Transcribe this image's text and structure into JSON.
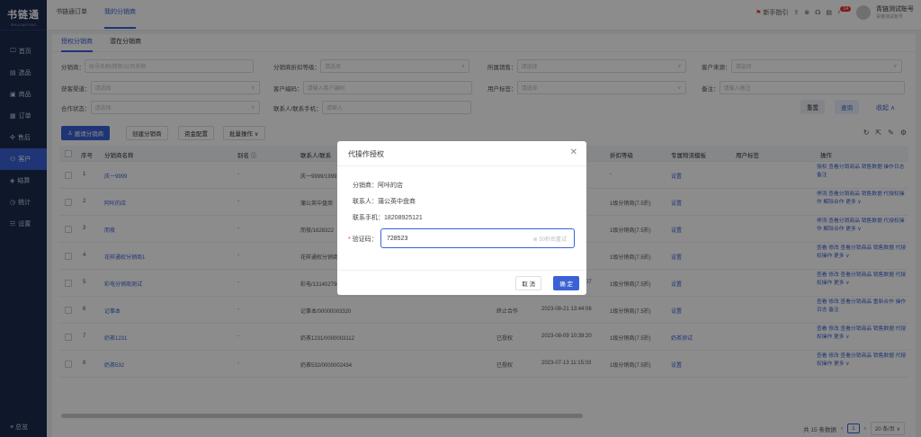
{
  "app": {
    "name": "书链通",
    "subname": "SHULIANTONG"
  },
  "sidebar": {
    "items": [
      {
        "icon": "🖵",
        "label": "首页"
      },
      {
        "icon": "▤",
        "label": "选品"
      },
      {
        "icon": "▣",
        "label": "商品"
      },
      {
        "icon": "▦",
        "label": "订单"
      },
      {
        "icon": "✣",
        "label": "售后"
      },
      {
        "icon": "⚇",
        "label": "客户"
      },
      {
        "icon": "◈",
        "label": "结算"
      },
      {
        "icon": "◷",
        "label": "统计"
      },
      {
        "icon": "☷",
        "label": "设置"
      }
    ],
    "footer": "≡ 总览"
  },
  "topbar": {
    "tabs": [
      "书链通订单",
      "我的分销商"
    ],
    "guide": "新手指引",
    "badge": "14",
    "user": "青链测试账号",
    "role": "青链测试账号"
  },
  "subtabs": [
    "授权分销商",
    "潜在分销商"
  ],
  "filters": {
    "distributor_label": "分销商：",
    "distributor_placeholder": "账号名称/简称/公司名称",
    "discount_label": "分销商折扣等级：",
    "discount_placeholder": "请选择",
    "sales_label": "所属销售：",
    "sales_placeholder": "请选择",
    "source_label": "客户来源：",
    "source_placeholder": "请选择",
    "channel_label": "获客渠道：",
    "channel_placeholder": "请选择",
    "code_label": "客户编码：",
    "code_placeholder": "请输入客户编码",
    "tag_label": "用户标签：",
    "tag_placeholder": "请选择",
    "note_label": "备注：",
    "note_placeholder": "请输入备注",
    "coop_label": "合作状态：",
    "coop_placeholder": "请选择",
    "contact_label": "联系人/联系手机：",
    "contact_placeholder": "请输入",
    "reset": "重置",
    "search": "查询",
    "collapse": "收起 ∧"
  },
  "actions": {
    "invite": "邀请分销商",
    "create": "创建分销商",
    "fund": "资金配置",
    "batch": "批量操作 ∨"
  },
  "table": {
    "headers": [
      "序号",
      "分销商名称",
      "别名 ⓘ",
      "联系人/联系",
      "",
      "",
      "折扣等级",
      "专属物流模板",
      "用户标签",
      "操作"
    ],
    "rows": [
      {
        "no": "1",
        "name": "庆一9999",
        "alias": "-",
        "contact": "庆一9999/1999",
        "status": "",
        "date": "",
        "level": "-",
        "tpl": "设置",
        "ops": "授权 查看分销商品 销售数据 操作日志 备注"
      },
      {
        "no": "2",
        "name": "阿咔的店",
        "alias": "-",
        "contact": "蒲公英中盘商",
        "status": "",
        "date": "43",
        "level": "1级分销商(7.5折)",
        "tpl": "设置",
        "ops": "停流 查看分销商品 销售数据 代授权操作 解除合作 更多 ∨"
      },
      {
        "no": "3",
        "name": "而夜",
        "alias": "-",
        "contact": "而夜/1828322",
        "status": "",
        "date": "52",
        "level": "1级分销商(7.5折)",
        "tpl": "设置",
        "ops": "停流 查看分销商品 销售数据 代授权操作 解除合作 更多 ∨"
      },
      {
        "no": "4",
        "name": "花样通权分销商1",
        "alias": "-",
        "contact": "花样通权分销商",
        "status": "",
        "date": "36",
        "level": "1级分销商(7.5折)",
        "tpl": "设置",
        "ops": "查看 修改 查看分销商品 销售数据 代授权操作 更多 ∨"
      },
      {
        "no": "5",
        "name": "彩电分销商测试",
        "alias": "-",
        "contact": "彩电/13140279657",
        "status": "已授权",
        "date": "2023-09-04 16:34:07",
        "level": "1级分销商(7.5折)",
        "tpl": "设置",
        "ops": "查看 修改 查看分销商品 销售数据 代授权操作 更多 ∨"
      },
      {
        "no": "6",
        "name": "记事本",
        "alias": "-",
        "contact": "记事本/00000003320",
        "status": "终止合作",
        "date": "2023-08-21 13:44:06",
        "level": "1级分销商(7.5折)",
        "tpl": "设置",
        "ops": "查看 修改 查看分销商品 重新合作 操作日志 备注"
      },
      {
        "no": "7",
        "name": "奶茶1231",
        "alias": "-",
        "contact": "奶茶1231/0000003112",
        "status": "已授权",
        "date": "2023-08-09 10:39:20",
        "level": "1级分销商(7.5折)",
        "tpl": "奶茶测试",
        "ops": "查看 修改 查看分销商品 销售数据 代授权操作 更多 ∨"
      },
      {
        "no": "8",
        "name": "奶茶532",
        "alias": "-",
        "contact": "奶茶532/0000002434",
        "status": "已授权",
        "date": "2023-07-13 11:15:03",
        "level": "1级分销商(7.5折)",
        "tpl": "设置",
        "ops": "查看 修改 查看分销商品 销售数据 代授权操作 更多 ∨"
      }
    ]
  },
  "pager": {
    "total": "共 15 条数据",
    "page": "1",
    "size": "20 条/页 ∨"
  },
  "modal": {
    "title": "代操作授权",
    "distributor": "分销商：阿咔的店",
    "contact": "联系人：蒲公英中盘商",
    "phone": "联系手机：18208925121",
    "code_label": "验证码：",
    "code_value": "728523",
    "resend": "50秒后重试",
    "cancel": "取 消",
    "confirm": "确 定"
  }
}
